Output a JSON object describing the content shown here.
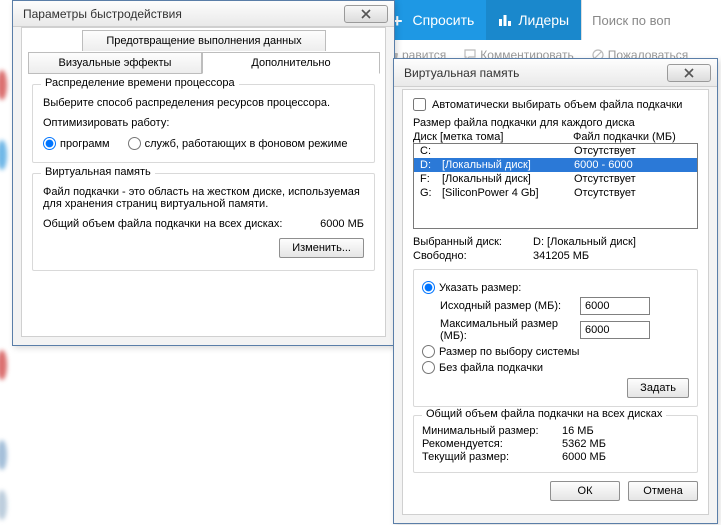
{
  "site": {
    "ask_label": "Спросить",
    "leaders_label": "Лидеры",
    "search_placeholder": "Поиск по воп",
    "like_label": "равится",
    "comment_label": "Комментировать",
    "report_label": "Пожаловаться"
  },
  "perf": {
    "title": "Параметры быстродействия",
    "tab_dep": "Предотвращение выполнения данных",
    "tab_vfx": "Визуальные эффекты",
    "tab_adv": "Дополнительно",
    "cpu_group": "Распределение времени процессора",
    "cpu_desc": "Выберите способ распределения ресурсов процессора.",
    "opt_label": "Оптимизировать работу:",
    "opt_programs": "программ",
    "opt_services": "служб, работающих в фоновом режиме",
    "vm_group": "Виртуальная память",
    "vm_desc": "Файл подкачки - это область на жестком диске, используемая для хранения страниц виртуальной памяти.",
    "vm_total_label": "Общий объем файла подкачки на всех дисках:",
    "vm_total_value": "6000 МБ",
    "change_btn": "Изменить..."
  },
  "vm": {
    "title": "Виртуальная память",
    "auto_chk": "Автоматически выбирать объем файла подкачки",
    "size_per_disk": "Размер файла подкачки для каждого диска",
    "col_disk": "Диск [метка тома]",
    "col_size": "Файл подкачки (МБ)",
    "rows": [
      {
        "drive": "C:",
        "label": "",
        "size": "Отсутствует",
        "sel": false
      },
      {
        "drive": "D:",
        "label": "[Локальный диск]",
        "size": "6000 - 6000",
        "sel": true
      },
      {
        "drive": "F:",
        "label": "[Локальный диск]",
        "size": "Отсутствует",
        "sel": false
      },
      {
        "drive": "G:",
        "label": "[SiliconPower 4 Gb]",
        "size": "Отсутствует",
        "sel": false
      }
    ],
    "selected_label": "Выбранный диск:",
    "selected_value": "D:   [Локальный диск]",
    "free_label": "Свободно:",
    "free_value": "341205 МБ",
    "opt_custom": "Указать размер:",
    "init_label": "Исходный размер (МБ):",
    "init_value": "6000",
    "max_label": "Максимальный размер (МБ):",
    "max_value": "6000",
    "opt_system": "Размер по выбору системы",
    "opt_none": "Без файла подкачки",
    "set_btn": "Задать",
    "total_group": "Общий объем файла подкачки на всех дисках",
    "min_label": "Минимальный размер:",
    "min_value": "16 МБ",
    "rec_label": "Рекомендуется:",
    "rec_value": "5362 МБ",
    "cur_label": "Текущий размер:",
    "cur_value": "6000 МБ",
    "ok": "ОК",
    "cancel": "Отмена"
  }
}
